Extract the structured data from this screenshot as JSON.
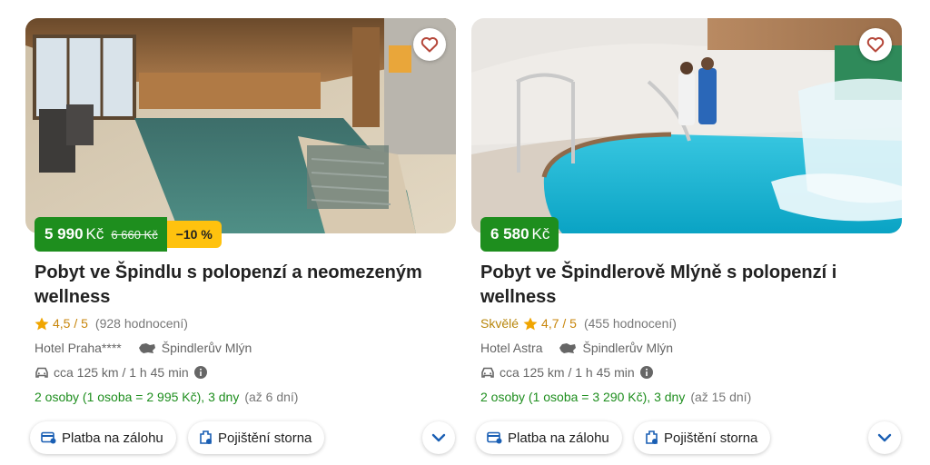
{
  "colors": {
    "price_bg": "#1e8e1e",
    "discount_bg": "#ffc20e",
    "star": "#f0a500",
    "accent_blue": "#1a5fb4",
    "heart": "#b5473a"
  },
  "cards": [
    {
      "price_now": "5 990",
      "currency": "Kč",
      "price_old": "6 660 Kč",
      "discount": "−10 %",
      "title": "Pobyt ve Špindlu s polopenzí a neomezeným wellness",
      "rating": "4,5 / 5",
      "reviews": "(928 hodnocení)",
      "hotel": "Hotel Praha****",
      "location": "Špindlerův Mlýn",
      "distance": "cca 125 km / 1 h 45 min",
      "stay": "2 osoby (1 osoba = 2 995 Kč), 3 dny",
      "stay_extra": "(až 6 dní)",
      "chip_payment": "Platba na zálohu",
      "chip_insurance": "Pojištění storna",
      "icons": [
        "heart-icon",
        "star-icon",
        "map-icon",
        "car-icon",
        "info-icon",
        "card-icon",
        "shield-icon",
        "chevron-down-icon"
      ]
    },
    {
      "price_now": "6 580",
      "currency": "Kč",
      "rating_word": "Skvělé",
      "title": "Pobyt ve Špindlerově Mlýně s polopenzí i wellness",
      "rating": "4,7 / 5",
      "reviews": "(455 hodnocení)",
      "hotel": "Hotel Astra",
      "location": "Špindlerův Mlýn",
      "distance": "cca 125 km / 1 h 45 min",
      "stay": "2 osoby (1 osoba = 3 290 Kč), 3 dny",
      "stay_extra": "(až 15 dní)",
      "chip_payment": "Platba na zálohu",
      "chip_insurance": "Pojištění storna",
      "icons": [
        "heart-icon",
        "star-icon",
        "map-icon",
        "car-icon",
        "info-icon",
        "card-icon",
        "shield-icon",
        "chevron-down-icon"
      ]
    }
  ]
}
